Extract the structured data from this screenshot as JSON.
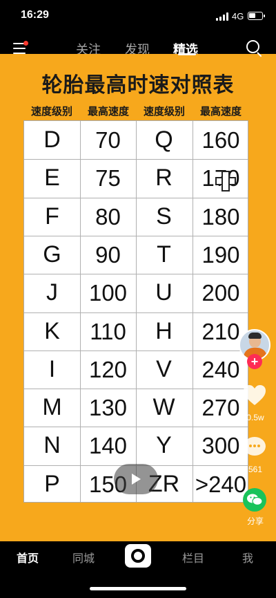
{
  "status_bar": {
    "time": "16:29",
    "network": "4G"
  },
  "top_nav": {
    "tabs": [
      {
        "label": "关注",
        "active": false
      },
      {
        "label": "发现",
        "active": false
      },
      {
        "label": "精选",
        "active": true
      }
    ],
    "menu_icon": "hamburger-menu-icon",
    "search_icon": "search-icon"
  },
  "video": {
    "background_color": "#f7a81c",
    "title": "轮胎最高时速对照表",
    "headers": [
      "速度级别",
      "最高速度",
      "速度级别",
      "最高速度"
    ],
    "rows": [
      [
        "D",
        "70",
        "Q",
        "160"
      ],
      [
        "E",
        "75",
        "R",
        "170"
      ],
      [
        "F",
        "80",
        "S",
        "180"
      ],
      [
        "G",
        "90",
        "T",
        "190"
      ],
      [
        "J",
        "100",
        "U",
        "200"
      ],
      [
        "K",
        "110",
        "H",
        "210"
      ],
      [
        "I",
        "120",
        "V",
        "240"
      ],
      [
        "M",
        "130",
        "W",
        "270"
      ],
      [
        "N",
        "140",
        "Y",
        "300"
      ],
      [
        "P",
        "150",
        "ZR",
        ">240"
      ]
    ],
    "play_icon": "play-icon"
  },
  "right_rail": {
    "like_count": "0.5w",
    "comment_count": "561",
    "share_label": "分享"
  },
  "bottom_nav": {
    "items": [
      {
        "label": "首页",
        "active": true
      },
      {
        "label": "同城",
        "active": false
      },
      {
        "label": "栏目",
        "active": false
      },
      {
        "label": "我",
        "active": false
      }
    ]
  }
}
